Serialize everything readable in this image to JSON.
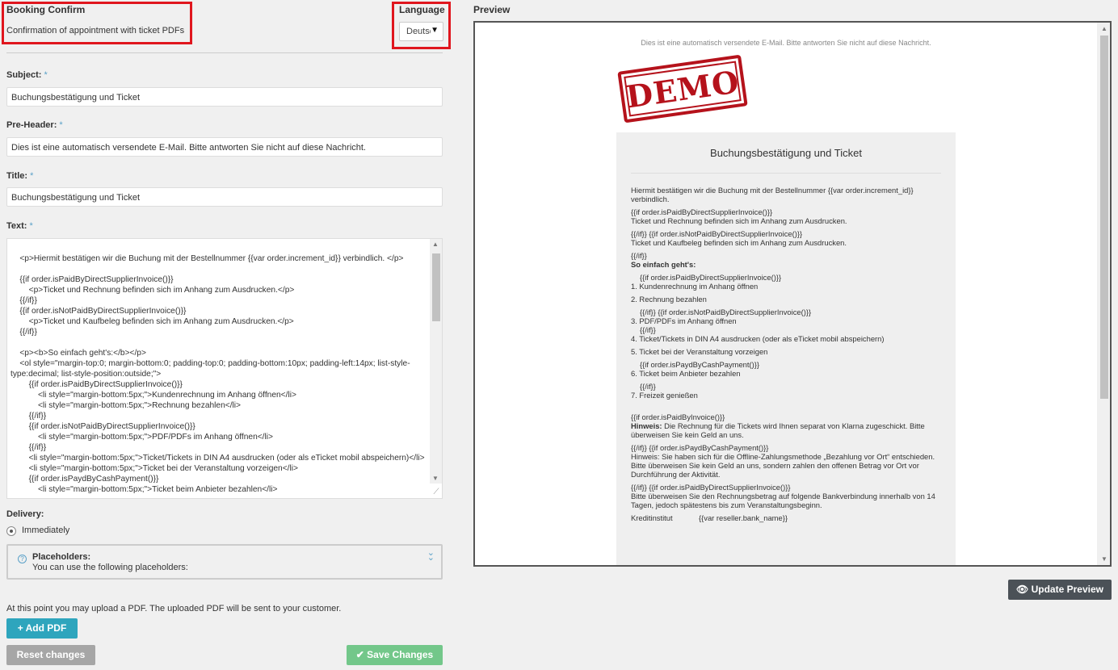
{
  "header": {
    "title": "Booking Confirm",
    "subtitle": "Confirmation of appointment with ticket PDFs",
    "language_label": "Language",
    "language_value": "Deutsch"
  },
  "form": {
    "subject": {
      "label": "Subject:",
      "value": "Buchungsbestätigung und Ticket"
    },
    "preheader": {
      "label": "Pre-Header:",
      "value": "Dies ist eine automatisch versendete E-Mail. Bitte antworten Sie nicht auf diese Nachricht."
    },
    "title": {
      "label": "Title:",
      "value": "Buchungsbestätigung und Ticket"
    },
    "text": {
      "label": "Text:",
      "lines": [
        "    <p>Hiermit bestätigen wir die Buchung mit der Bestellnummer {{var order.increment_id}} verbindlich. </p>",
        "",
        "    {{if order.isPaidByDirectSupplierInvoice()}}",
        "        <p>Ticket und Rechnung befinden sich im Anhang zum Ausdrucken.</p>",
        "    {{/if}}",
        "    {{if order.isNotPaidByDirectSupplierInvoice()}}",
        "        <p>Ticket und Kaufbeleg befinden sich im Anhang zum Ausdrucken.</p>",
        "    {{/if}}",
        "",
        "    <p><b>So einfach geht's:</b></p>",
        "    <ol style=\"margin-top:0; margin-bottom:0; padding-top:0; padding-bottom:10px; padding-left:14px; list-style-type:decimal; list-style-position:outside;\">",
        "        {{if order.isPaidByDirectSupplierInvoice()}}",
        "            <li style=\"margin-bottom:5px;\">Kundenrechnung im Anhang öffnen</li>",
        "            <li style=\"margin-bottom:5px;\">Rechnung bezahlen</li>",
        "        {{/if}}",
        "        {{if order.isNotPaidByDirectSupplierInvoice()}}",
        "            <li style=\"margin-bottom:5px;\">PDF/PDFs im Anhang öffnen</li>",
        "        {{/if}}",
        "        <li style=\"margin-bottom:5px;\">Ticket/Tickets in DIN A4 ausdrucken (oder als eTicket mobil abspeichern)</li>",
        "        <li style=\"margin-bottom:5px;\">Ticket bei der Veranstaltung vorzeigen</li>",
        "        {{if order.isPaydByCashPayment()}}",
        "            <li style=\"margin-bottom:5px;\">Ticket beim Anbieter bezahlen</li>"
      ]
    },
    "delivery": {
      "label": "Delivery:",
      "option": "Immediately"
    },
    "placeholders": {
      "title": "Placeholders:",
      "subtitle": "You can use the following placeholders:"
    },
    "upload_text": "At this point you may upload a PDF. The uploaded PDF will be sent to your customer.",
    "add_pdf": "Add PDF",
    "reset": "Reset changes",
    "save": "Save Changes"
  },
  "preview": {
    "label": "Preview",
    "update_button": "Update Preview",
    "preheader": "Dies ist eine automatisch versendete E-Mail. Bitte antworten Sie nicht auf diese Nachricht.",
    "stamp_text": "DEMO",
    "title": "Buchungsbestätigung und Ticket",
    "p1": "Hiermit bestätigen wir die Buchung mit der Bestellnummer {{var order.increment_id}} verbindlich.",
    "p2a": "{{if order.isPaidByDirectSupplierInvoice()}}",
    "p2b": "Ticket und Rechnung befinden sich im Anhang zum Ausdrucken.",
    "p3a": "{{/if}} {{if order.isNotPaidByDirectSupplierInvoice()}}",
    "p3b": "Ticket und Kaufbeleg befinden sich im Anhang zum Ausdrucken.",
    "p4a": "{{/if}}",
    "p4b": "So einfach geht's:",
    "list": [
      "{{if order.isPaidByDirectSupplierInvoice()}}",
      "1. Kundenrechnung im Anhang öffnen",
      "2. Rechnung bezahlen",
      "{{/if}} {{if order.isNotPaidByDirectSupplierInvoice()}}",
      "3. PDF/PDFs im Anhang öffnen",
      "{{/if}}",
      "4. Ticket/Tickets in DIN A4 ausdrucken (oder als eTicket mobil abspeichern)",
      "5. Ticket bei der Veranstaltung vorzeigen",
      "{{if order.isPaydByCashPayment()}}",
      "6. Ticket beim Anbieter bezahlen",
      "{{/if}}",
      "7. Freizeit genießen"
    ],
    "p5a": "{{if order.isPaidByInvoice()}}",
    "p5b_bold": "Hinweis:",
    "p5b": " Die Rechnung für die Tickets wird Ihnen separat von Klarna zugeschickt. Bitte überweisen Sie kein Geld an uns.",
    "p6a": "{{/if}} {{if order.isPaydByCashPayment()}}",
    "p6b": "Hinweis: Sie haben sich für die Offline-Zahlungsmethode „Bezahlung vor Ort“ entschieden. Bitte überweisen Sie kein Geld an uns, sondern zahlen den offenen Betrag vor Ort vor Durchführung der Aktivität.",
    "p7a": "{{/if}} {{if order.isPaidByDirectSupplierInvoice()}}",
    "p7b": "Bitte überweisen Sie den Rechnungsbetrag auf folgende Bankverbindung innerhalb von 14 Tagen, jedoch spätestens bis zum Veranstaltungsbeginn.",
    "bank_label": "Kreditinstitut",
    "bank_value": "{{var reseller.bank_name}}"
  }
}
